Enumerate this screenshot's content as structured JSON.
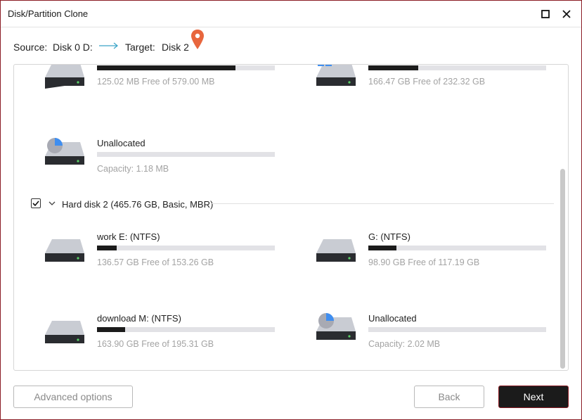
{
  "window": {
    "title": "Disk/Partition Clone",
    "border_color": "#8b1c24"
  },
  "source_bar": {
    "source_label": "Source:",
    "source_value": "Disk 0 D:",
    "target_label": "Target:",
    "target_value": "Disk 2",
    "arrow_color": "#3aa5c8",
    "pin_color": "#e8663d"
  },
  "disk0_partitions": [
    {
      "name": "",
      "used_fraction": 0.78,
      "info": "125.02 MB Free of 579.00 MB",
      "icon": "hard-drive-icon"
    },
    {
      "name": "",
      "used_fraction": 0.28,
      "info": "166.47 GB Free of 232.32 GB",
      "icon": "windows-drive-icon"
    },
    {
      "name": "Unallocated",
      "used_fraction": 0,
      "info": "Capacity: 1.18 MB",
      "icon": "unallocated-drive-icon"
    }
  ],
  "disk2": {
    "checked": true,
    "label": "Hard disk 2 (465.76 GB, Basic, MBR)",
    "partitions": [
      {
        "name": "work E: (NTFS)",
        "used_fraction": 0.11,
        "info": "136.57 GB Free of 153.26 GB",
        "icon": "hard-drive-icon"
      },
      {
        "name": "G: (NTFS)",
        "used_fraction": 0.16,
        "info": "98.90 GB Free of 117.19 GB",
        "icon": "hard-drive-icon"
      },
      {
        "name": "download M: (NTFS)",
        "used_fraction": 0.16,
        "info": "163.90 GB Free of 195.31 GB",
        "icon": "hard-drive-icon"
      },
      {
        "name": "Unallocated",
        "used_fraction": 0,
        "info": "Capacity: 2.02 MB",
        "icon": "unallocated-drive-icon"
      }
    ]
  },
  "buttons": {
    "advanced": "Advanced options",
    "back": "Back",
    "next": "Next"
  },
  "colors": {
    "pie_blue": "#3f8ef0",
    "bar_fill": "#1c1c1c",
    "bar_track": "#e2e2e6"
  }
}
